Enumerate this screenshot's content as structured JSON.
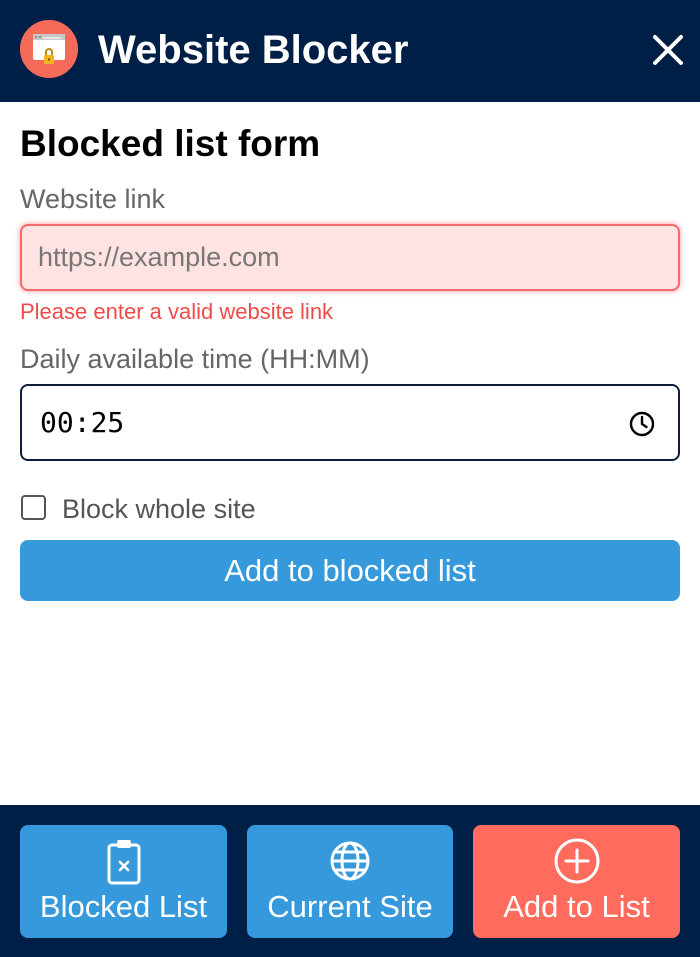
{
  "header": {
    "title": "Website Blocker",
    "logo_icon": "locked-browser-icon",
    "close_icon": "close-icon"
  },
  "form": {
    "title": "Blocked list form",
    "link_label": "Website link",
    "link_placeholder": "https://example.com",
    "link_value": "",
    "link_error": "Please enter a valid website link",
    "time_label": "Daily available time (HH:MM)",
    "time_value": "00:25",
    "time_icon": "clock-icon",
    "block_whole_site_label": "Block whole site",
    "block_whole_site_checked": false,
    "submit_label": "Add to blocked list"
  },
  "nav": {
    "items": [
      {
        "label": "Blocked List",
        "icon": "clipboard-x-icon",
        "active": false
      },
      {
        "label": "Current Site",
        "icon": "globe-icon",
        "active": false
      },
      {
        "label": "Add to List",
        "icon": "plus-circle-icon",
        "active": true
      }
    ]
  },
  "colors": {
    "header_bg": "#001f47",
    "primary": "#3699db",
    "accent": "#ff6b5c",
    "error": "#ef4b4b",
    "error_bg": "#ffe2e2"
  }
}
